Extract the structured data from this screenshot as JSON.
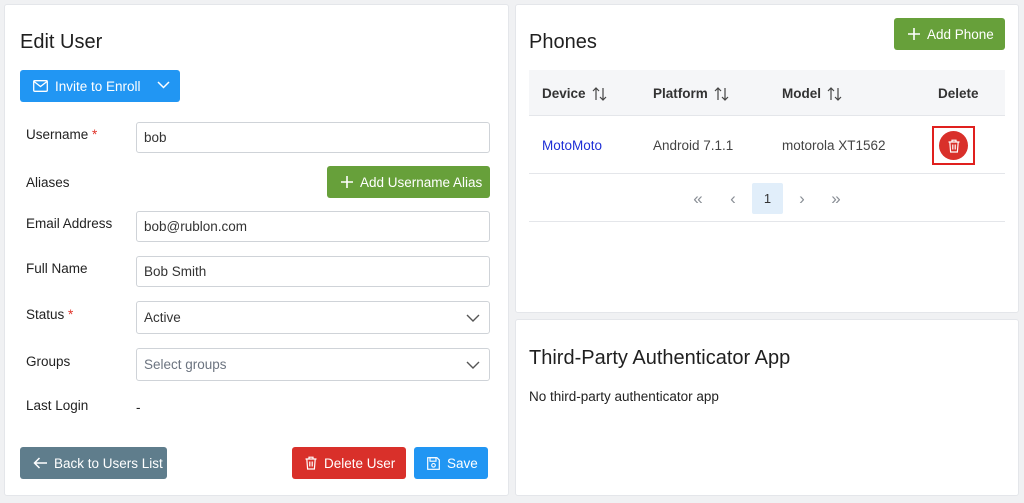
{
  "edit_user": {
    "title": "Edit User",
    "invite_button": "Invite to Enroll",
    "username_label": "Username",
    "required_mark": "*",
    "username_value": "bob",
    "aliases_label": "Aliases",
    "add_alias_button": "Add Username Alias",
    "email_label": "Email Address",
    "email_value": "bob@rublon.com",
    "fullname_label": "Full Name",
    "fullname_value": "Bob Smith",
    "status_label": "Status",
    "status_value": "Active",
    "groups_label": "Groups",
    "groups_placeholder": "Select groups",
    "last_login_label": "Last Login",
    "last_login_value": "-",
    "back_button": "Back to Users List",
    "delete_button": "Delete User",
    "save_button": "Save"
  },
  "phones": {
    "title": "Phones",
    "add_button": "Add Phone",
    "columns": [
      "Device",
      "Platform",
      "Model",
      "Delete"
    ],
    "rows": [
      {
        "device": "MotoMoto",
        "platform": "Android 7.1.1",
        "model": "motorola XT1562"
      }
    ],
    "pagination": {
      "first": "«",
      "prev": "‹",
      "current": "1",
      "next": "›",
      "last": "»"
    }
  },
  "third_party": {
    "title": "Third-Party Authenticator App",
    "empty_text": "No third-party authenticator app"
  },
  "colors": {
    "blue": "#2196f3",
    "green": "#67a03a",
    "red": "#d9302a",
    "slate": "#5f7d8c",
    "link": "#1e2fd6"
  }
}
